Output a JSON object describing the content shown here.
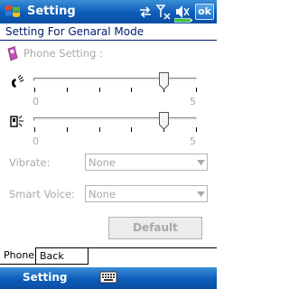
{
  "titlebar": {
    "title": "Setting",
    "ok_label": "ok",
    "icons": [
      "windows-start-icon",
      "connectivity-icon",
      "signal-icon",
      "volume-icon",
      "battery-icon"
    ],
    "colors": {
      "bar_top": "#3b8fd6",
      "bar_bottom": "#0a4ea2"
    }
  },
  "header": {
    "title": "Setting For Genaral Mode"
  },
  "phone_setting": {
    "label": "Phone Setting :",
    "sliders": [
      {
        "name": "ringer-volume",
        "icon": "ringer-icon",
        "min_label": "0",
        "max_label": "5",
        "min": 0,
        "max": 5,
        "value": 4
      },
      {
        "name": "speaker-volume",
        "icon": "speaker-icon",
        "min_label": "0",
        "max_label": "5",
        "min": 0,
        "max": 5,
        "value": 4
      }
    ]
  },
  "vibrate": {
    "label": "Vibrate:",
    "value": "None"
  },
  "smart_voice": {
    "label": "Smart Voice:",
    "value": "None"
  },
  "default_button": {
    "label": "Default"
  },
  "tabs": [
    {
      "label": "Phone",
      "active": true
    },
    {
      "label": "Back Light",
      "active": false
    }
  ],
  "menubar": {
    "left_label": "Setting",
    "sip_icon": "keyboard-icon"
  }
}
